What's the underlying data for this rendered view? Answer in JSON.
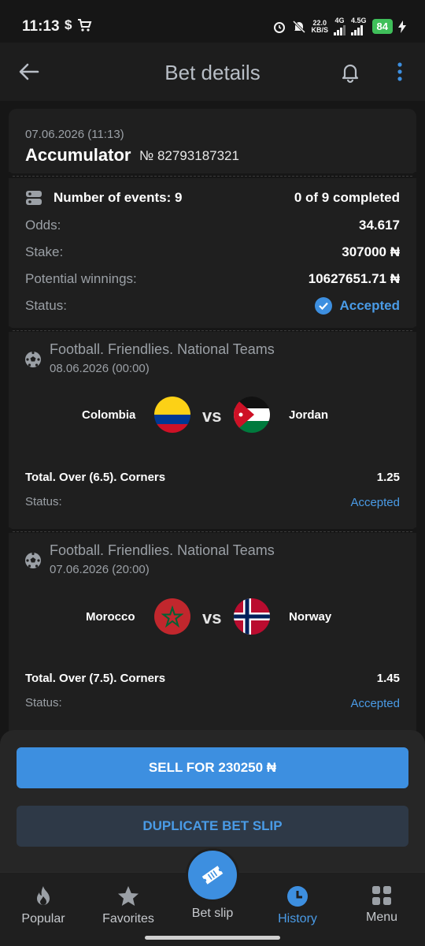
{
  "status_bar": {
    "time": "11:13",
    "net_speed_value": "22.0",
    "net_speed_unit": "KB/S",
    "net_1": "4G",
    "net_2": "4.5G",
    "battery": "84"
  },
  "header": {
    "title": "Bet details"
  },
  "bet": {
    "date": "07.06.2026 (11:13)",
    "type": "Accumulator",
    "number": "№ 82793187321",
    "events_label": "Number of events: 9",
    "completed": "0 of 9 completed",
    "odds_label": "Odds:",
    "odds": "34.617",
    "stake_label": "Stake:",
    "stake": "307000 ₦",
    "winnings_label": "Potential winnings:",
    "winnings": "10627651.71 ₦",
    "status_label": "Status:",
    "status": "Accepted"
  },
  "events": [
    {
      "league": "Football. Friendlies. National Teams",
      "date": "08.06.2026 (00:00)",
      "home": "Colombia",
      "away": "Jordan",
      "vs": "vs",
      "market": "Total. Over (6.5). Corners",
      "odd": "1.25",
      "status_label": "Status:",
      "status": "Accepted"
    },
    {
      "league": "Football. Friendlies. National Teams",
      "date": "07.06.2026 (20:00)",
      "home": "Morocco",
      "away": "Norway",
      "vs": "vs",
      "market": "Total. Over (7.5). Corners",
      "odd": "1.45",
      "status_label": "Status:",
      "status": "Accepted"
    }
  ],
  "actions": {
    "sell": "SELL FOR 230250 ₦",
    "duplicate": "DUPLICATE BET SLIP"
  },
  "nav": {
    "items": [
      "Popular",
      "Favorites",
      "Bet slip",
      "History",
      "Menu"
    ],
    "active": "History"
  },
  "colors": {
    "accent": "#3d8fe0",
    "accepted": "#4a9be6",
    "background": "#161616",
    "card": "#1f1f1f"
  }
}
